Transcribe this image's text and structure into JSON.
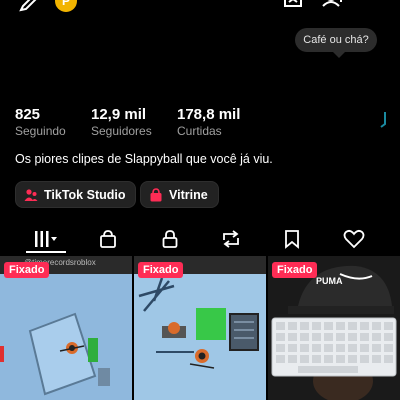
{
  "header": {
    "coin_label": "P",
    "bubble_text": "Café ou chá?"
  },
  "stats": [
    {
      "value": "825",
      "label": "Seguindo"
    },
    {
      "value": "12,9 mil",
      "label": "Seguidores"
    },
    {
      "value": "178,8 mil",
      "label": "Curtidas"
    }
  ],
  "bio": "Os piores clipes de Slappyball que você já viu.",
  "buttons": {
    "studio": "TikTok Studio",
    "vitrine": "Vitrine"
  },
  "tabs": [
    {
      "icon": "grid-icon",
      "active": true
    },
    {
      "icon": "shop-bag-icon"
    },
    {
      "icon": "lock-icon"
    },
    {
      "icon": "repost-icon"
    },
    {
      "icon": "bookmark-icon"
    },
    {
      "icon": "heart-icon"
    }
  ],
  "videos": [
    {
      "badge": "Fixado",
      "watermark": "@timerecordsroblox"
    },
    {
      "badge": "Fixado",
      "watermark": ""
    },
    {
      "badge": "Fixado",
      "cap_text": "PUMA"
    }
  ],
  "colors": {
    "accent": "#fe2c55",
    "coin": "#f2b400",
    "background": "#000000"
  }
}
